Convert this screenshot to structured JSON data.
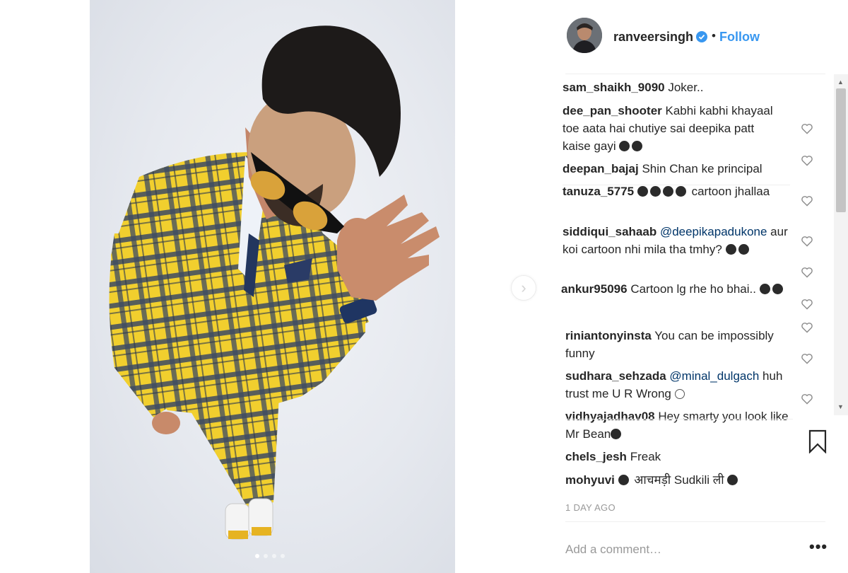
{
  "post": {
    "username": "ranveersingh",
    "separator": "•",
    "follow_label": "Follow",
    "verified_icon": "verified-badge-icon",
    "accent_color": "#3897f0",
    "carousel": {
      "slide_count": 4,
      "active_index": 0
    }
  },
  "comments": [
    {
      "user": "sam_shaikh_9090",
      "text": "Joker.."
    },
    {
      "user": "dee_pan_shooter",
      "text": "Kabhi kabhi khayaal toe aata hai chutiye sai deepika patt kaise gayi"
    },
    {
      "user": "deepan_bajaj",
      "text": "Shin Chan ke principal"
    },
    {
      "user": "tanuza_5775",
      "text": "cartoon jhallaa"
    },
    {
      "user": "siddiqui_sahaab",
      "mention": "@deepikapadukone",
      "text": "aur koi cartoon nhi mila tha tmhy?"
    },
    {
      "user": "ankur95096",
      "text": "Cartoon lg rhe ho bhai.."
    },
    {
      "user": "riniantonyinsta",
      "text": "You can be impossibly funny"
    },
    {
      "user": "sudhara_sehzada",
      "mention": "@minal_dulgach",
      "text": "huh trust me U R Wrong"
    },
    {
      "user": "vidhyajadhav08",
      "text": "Hey smarty you look like Mr Bean"
    },
    {
      "user": "chels_jesh",
      "text": "Freak"
    },
    {
      "user": "mohyuvi",
      "text": "आचमड़ी Sudkili ली"
    }
  ],
  "timestamp": "1 DAY AGO",
  "comment_input": {
    "placeholder": "Add a comment…",
    "value": ""
  },
  "more_label": "•••"
}
